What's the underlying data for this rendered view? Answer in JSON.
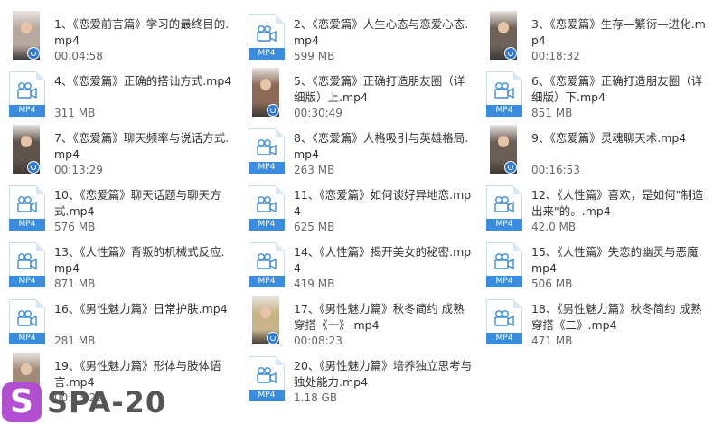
{
  "files": [
    {
      "name": "1、《恋爱前言篇》学习的最终目的.mp4",
      "meta": "00:04:58",
      "kind": "video",
      "thumb": "#b7a8a0"
    },
    {
      "name": "2、《恋爱篇》人生心态与恋爱心态.mp4",
      "meta": "599 MB",
      "kind": "mp4"
    },
    {
      "name": "3、《恋爱篇》生存—繁衍—进化.mp4",
      "meta": "00:18:32",
      "kind": "video",
      "thumb": "#6e6258"
    },
    {
      "name": "4、《恋爱篇》正确的搭讪方式.mp4",
      "meta": "311 MB",
      "kind": "mp4"
    },
    {
      "name": "5、《恋爱篇》正确打造朋友圈（详细版）上.mp4",
      "meta": "00:30:49",
      "kind": "video",
      "thumb": "#8b6b58"
    },
    {
      "name": "6、《恋爱篇》正确打造朋友圈（详细版）下.mp4",
      "meta": "851 MB",
      "kind": "mp4"
    },
    {
      "name": "7、《恋爱篇》聊天频率与说话方式.mp4",
      "meta": "00:13:29",
      "kind": "video",
      "thumb": "#5f544c"
    },
    {
      "name": "8、《恋爱篇》人格吸引与英雄格局.mp4",
      "meta": "263 MB",
      "kind": "mp4"
    },
    {
      "name": "9、《恋爱篇》灵魂聊天术.mp4",
      "meta": "00:16:53",
      "kind": "video",
      "thumb": "#6a5f56"
    },
    {
      "name": "10、《恋爱篇》聊天话题与聊天方式.mp4",
      "meta": "576 MB",
      "kind": "mp4"
    },
    {
      "name": "11、《恋爱篇》如何谈好异地恋.mp4",
      "meta": "625 MB",
      "kind": "mp4"
    },
    {
      "name": "12、《人性篇》喜欢，是如何\"制造出来\"的。.mp4",
      "meta": "42.0 MB",
      "kind": "mp4"
    },
    {
      "name": "13、《人性篇》背叛的机械式反应.mp4",
      "meta": "871 MB",
      "kind": "mp4"
    },
    {
      "name": "14、《人性篇》揭开美女的秘密.mp4",
      "meta": "419 MB",
      "kind": "mp4"
    },
    {
      "name": "15、《人性篇》失恋的幽灵与恶魔.mp4",
      "meta": "506 MB",
      "kind": "mp4"
    },
    {
      "name": "16、《男性魅力篇》日常护肤.mp4",
      "meta": "281 MB",
      "kind": "mp4"
    },
    {
      "name": "17、《男性魅力篇》秋冬简约 成熟穿搭《一》.mp4",
      "meta": "00:08:23",
      "kind": "video",
      "thumb": "#c9b48a"
    },
    {
      "name": "18、《男性魅力篇》秋冬简约 成熟穿搭《二》.mp4",
      "meta": "471 MB",
      "kind": "mp4"
    },
    {
      "name": "19、《男性魅力篇》形体与肢体语言.mp4",
      "meta": "00:13:29",
      "kind": "video",
      "thumb": "#a08a78"
    },
    {
      "name": "20、《男性魅力篇》培养独立思考与独处能力.mp4",
      "meta": "1.18 GB",
      "kind": "mp4"
    }
  ],
  "mp4_label": "MP4",
  "watermark": {
    "letter": "S",
    "text": "SPA-20",
    "color": "#b24fd0"
  }
}
